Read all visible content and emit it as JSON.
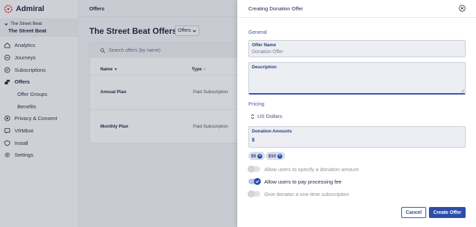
{
  "app": {
    "name": "Admiral"
  },
  "org": {
    "parent": "The Street Beat",
    "name": "The Street Beat"
  },
  "nav": {
    "items": [
      {
        "label": "Analytics",
        "icon": "home-icon"
      },
      {
        "label": "Journeys",
        "icon": "journey-icon"
      },
      {
        "label": "Subscriptions",
        "icon": "subscriptions-icon"
      },
      {
        "label": "Offers",
        "icon": "offers-icon",
        "active": true
      },
      {
        "label": "Privacy & Consent",
        "icon": "privacy-icon"
      },
      {
        "label": "VRMbot",
        "icon": "chat-icon"
      },
      {
        "label": "Install",
        "icon": "shield-icon"
      },
      {
        "label": "Settings",
        "icon": "gear-icon"
      }
    ],
    "sub_items": [
      "Offer Groups",
      "Benefits"
    ]
  },
  "main": {
    "breadcrumb": "Offers",
    "title": "The Street Beat Offers",
    "view_select": "Offers",
    "search_placeholder": "Search offers (by name)",
    "columns": {
      "name": "Name",
      "type": "Type"
    },
    "rows": [
      {
        "name": "Annual Plan",
        "type": "Paid Subscription"
      },
      {
        "name": "Monthly Plan",
        "type": "Paid Subscription"
      }
    ]
  },
  "panel": {
    "title": "Creating Donation Offer",
    "general_label": "General",
    "offer_name_label": "Offer Name",
    "offer_name_placeholder": "Donation Offer",
    "description_label": "Description",
    "pricing_label": "Pricing",
    "currency": "US Dollars",
    "donation_amounts_label": "Donation Amounts",
    "currency_symbol": "$",
    "amounts": [
      "$5",
      "$10"
    ],
    "toggles": [
      {
        "label": "Allow users to specify a donation amount",
        "on": false
      },
      {
        "label": "Allow users to pay processing fee",
        "on": true
      },
      {
        "label": "Give donator a one-time subscription",
        "on": false
      }
    ],
    "cancel_label": "Cancel",
    "create_label": "Create Offer"
  },
  "colors": {
    "accent": "#2d4ea8",
    "sidebar_bg": "#f3f4f7",
    "brand_red": "#d6383a"
  }
}
